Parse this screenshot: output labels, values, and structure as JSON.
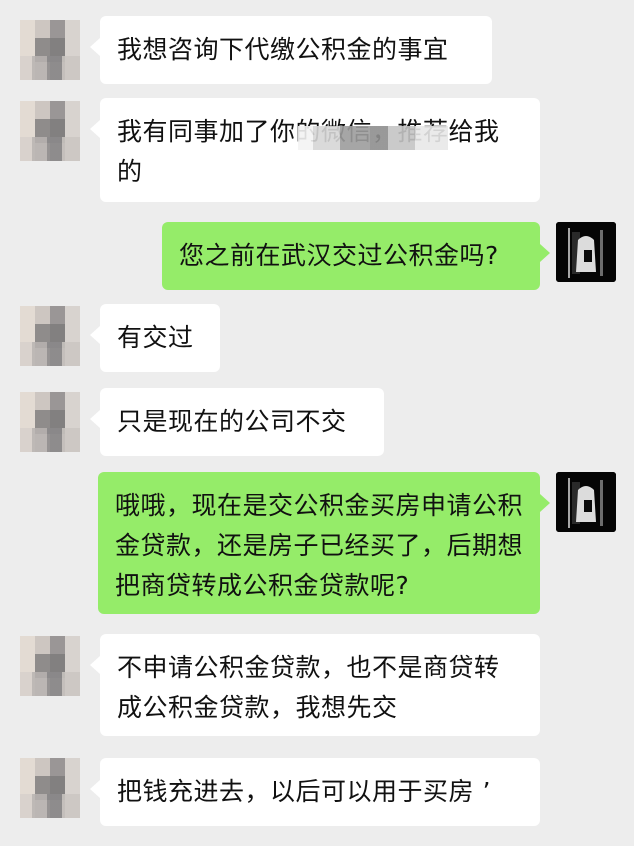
{
  "messages": [
    {
      "side": "left",
      "text": "我想咨询下代缴公积金的事宜"
    },
    {
      "side": "left",
      "text": "我有同事加了你的微信，推荐给我的"
    },
    {
      "side": "right",
      "text": "您之前在武汉交过公积金吗?"
    },
    {
      "side": "left",
      "text": "有交过"
    },
    {
      "side": "left",
      "text": "只是现在的公司不交"
    },
    {
      "side": "right",
      "text": "哦哦，现在是交公积金买房申请公积金贷款，还是房子已经买了，后期想把商贷转成公积金贷款呢?"
    },
    {
      "side": "left",
      "text": "不申请公积金贷款，也不是商贷转成公积金贷款，我想先交"
    },
    {
      "side": "left",
      "text": "把钱充进去，以后可以用于买房 ’"
    }
  ]
}
